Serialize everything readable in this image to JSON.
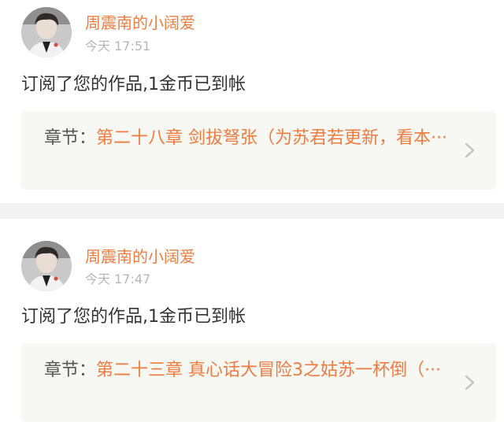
{
  "feed": {
    "items": [
      {
        "username": "周震南的小阔爱",
        "time": "今天 17:51",
        "message": "订阅了您的作品,1金币已到帐",
        "chapter_prefix": "章节：",
        "chapter_title": "第二十八章 剑拔弩张（为苏君若更新，看本···"
      },
      {
        "username": "周震南的小阔爱",
        "time": "今天 17:47",
        "message": "订阅了您的作品,1金币已到帐",
        "chapter_prefix": "章节：",
        "chapter_title": "第二十三章 真心话大冒险3之姑苏一杯倒（···"
      }
    ]
  },
  "icons": {
    "avatar": "user-avatar-photo",
    "chevron": "chevron-right-icon"
  },
  "colors": {
    "accent": "#f07b3f",
    "text": "#333333",
    "muted": "#b6b6b6",
    "chapter_bg": "#f7f7f3",
    "separator": "#f3f3f3"
  }
}
